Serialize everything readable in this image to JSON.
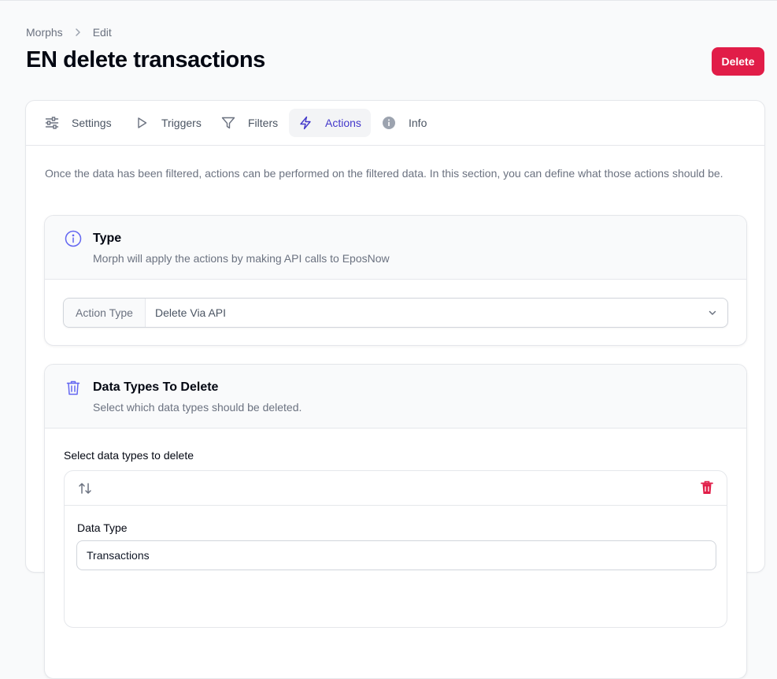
{
  "breadcrumb": {
    "root": "Morphs",
    "current": "Edit"
  },
  "page": {
    "title": "EN delete transactions",
    "delete_label": "Delete"
  },
  "tabs": [
    {
      "label": "Settings",
      "icon": "sliders-icon"
    },
    {
      "label": "Triggers",
      "icon": "play-icon"
    },
    {
      "label": "Filters",
      "icon": "funnel-icon"
    },
    {
      "label": "Actions",
      "icon": "bolt-icon",
      "active": true
    },
    {
      "label": "Info",
      "icon": "info-icon"
    }
  ],
  "intro": "Once the data has been filtered, actions can be performed on the filtered data. In this section, you can define what those actions should be.",
  "type_section": {
    "title": "Type",
    "description": "Morph will apply the actions by making API calls to EposNow",
    "action_type_label": "Action Type",
    "action_type_value": "Delete Via API"
  },
  "delete_section": {
    "title": "Data Types To Delete",
    "description": "Select which data types should be deleted.",
    "list_label": "Select data types to delete",
    "item": {
      "field_label": "Data Type",
      "value": "Transactions"
    }
  },
  "colors": {
    "accent": "#4338ca",
    "danger": "#e11d48",
    "icon_indigo": "#6366f1"
  }
}
